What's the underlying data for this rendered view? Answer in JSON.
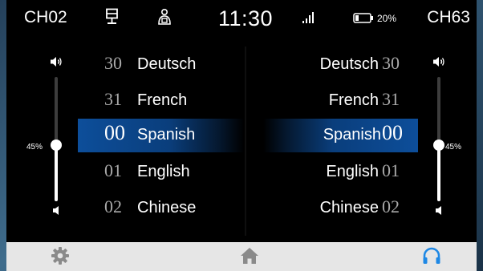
{
  "status_bar": {
    "left_channel": "CH02",
    "right_channel": "CH63",
    "clock": "11:30",
    "battery_percent": "20%",
    "icons": [
      "screen-mirror-icon",
      "seat-person-icon",
      "signal-bars-icon",
      "battery-icon"
    ]
  },
  "left_panel": {
    "volume": {
      "label": "45%",
      "level": 0.45
    },
    "languages": [
      {
        "num": "30",
        "name": "Deutsch",
        "selected": false
      },
      {
        "num": "31",
        "name": "French",
        "selected": false
      },
      {
        "num": "00",
        "name": "Spanish",
        "selected": true
      },
      {
        "num": "01",
        "name": "English",
        "selected": false
      },
      {
        "num": "02",
        "name": "Chinese",
        "selected": false
      }
    ]
  },
  "right_panel": {
    "volume": {
      "label": "45%",
      "level": 0.45
    },
    "languages": [
      {
        "num": "30",
        "name": "Deutsch",
        "selected": false
      },
      {
        "num": "31",
        "name": "French",
        "selected": false
      },
      {
        "num": "00",
        "name": "Spanish",
        "selected": true
      },
      {
        "num": "01",
        "name": "English",
        "selected": false
      },
      {
        "num": "02",
        "name": "Chinese",
        "selected": false
      }
    ]
  },
  "bottom_nav": {
    "items": [
      "settings-gear-icon",
      "home-icon",
      "headphones-icon"
    ],
    "active": "headphones-icon"
  },
  "colors": {
    "selection_blue": "#0d4e9a",
    "active_nav": "#1e88e5",
    "inactive_nav": "#8a8a8a",
    "nav_background": "#e6e6e6"
  }
}
